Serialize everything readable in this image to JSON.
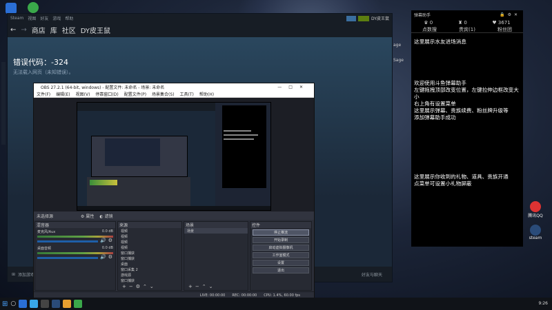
{
  "desktop": {
    "icon_right_1": "腾讯QQ",
    "icon_right_2": "steam",
    "side_label_1": "age",
    "side_label_2": "Sage"
  },
  "steam": {
    "title_menu": [
      "Steam",
      "视图",
      "好友",
      "游戏",
      "帮助"
    ],
    "nav": [
      "商店",
      "库",
      "社区",
      "DY皮王鼠"
    ],
    "user": "DY皮王鼠",
    "error_code": "错误代码：-324",
    "error_message": "无法载入网页（未知错误）。",
    "footer_left": "添加游戏",
    "footer_right": "好友与聊天"
  },
  "obs": {
    "title": "OBS 27.2.1 (64-bit, windows) - 配置文件: 未命名 - 场景: 未命名",
    "menu": [
      "文件(F)",
      "编辑(E)",
      "视图(V)",
      "停靠窗口(D)",
      "配置文件(P)",
      "场景集合(S)",
      "工具(T)",
      "帮助(H)"
    ],
    "no_source": "未选择源",
    "properties": "属性",
    "filters": "滤镜",
    "panels": {
      "mixer": "混音器",
      "sources": "来源",
      "scenes": "场景",
      "controls": "控件"
    },
    "mixer": [
      {
        "name": "麦克风/Aux",
        "db": "0.0 dB"
      },
      {
        "name": "桌面音频",
        "db": "0.0 dB"
      }
    ],
    "sources": [
      "视频",
      "视频",
      "视频",
      "视频",
      "窗口捕获",
      "窗口捕获",
      "桌面",
      "窗口采集 2",
      "游戏源",
      "窗口捕获"
    ],
    "scenes": [
      "场景"
    ],
    "controls": [
      "停止推流",
      "开始录制",
      "启动虚拟摄像机",
      "工作室模式",
      "设置",
      "退出"
    ],
    "status": {
      "live": "LIVE: 00:00:00",
      "rec": "REC: 00:00:00",
      "cpu": "CPU: 1.4%, 60.00 fps"
    }
  },
  "danmu": {
    "title": "弹幕助手",
    "stats": {
      "gift": "0",
      "vip": "0",
      "heart": "3671"
    },
    "tabs": [
      "点数搜",
      "贵宾(1)",
      "粉丝团"
    ],
    "msg1": "这里展示水友进场消息",
    "msg2": [
      "欢迎使用斗鱼弹幕助手",
      "左键拖拽顶部改变位置，左键拉伸边框改变大小",
      "右上角有设置菜单",
      "这里展示弹幕、贵族续费、粉丝牌升级等",
      "添加弹幕助手成功"
    ],
    "msg3": [
      "这里展示你收到的礼物、道具、贵族开通",
      "点菜单可设置小礼物屏蔽"
    ]
  },
  "taskbar": {
    "clock": "9:26"
  }
}
